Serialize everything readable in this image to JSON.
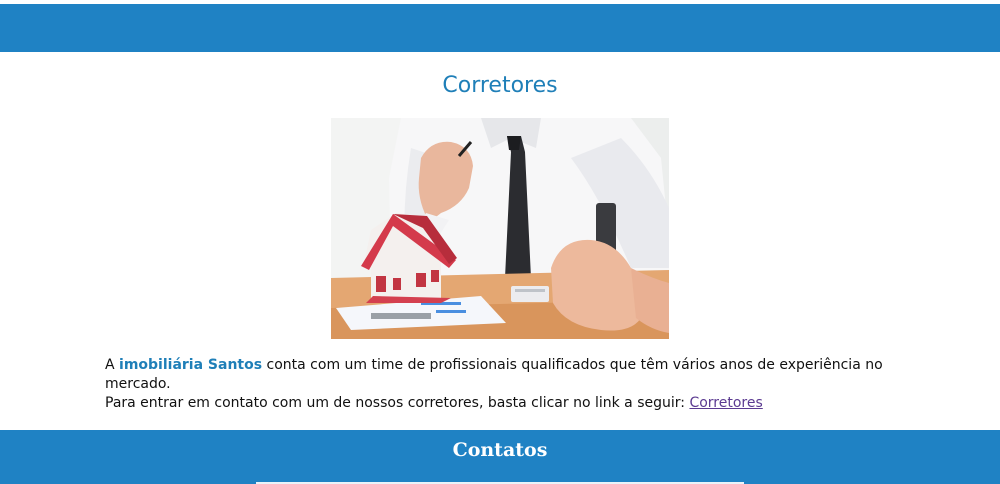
{
  "header": {
    "color": "#1f82c4"
  },
  "main": {
    "title": "Corretores",
    "image": {
      "icon": "realtor-with-house-model-photo"
    },
    "paragraph": {
      "prefix": "A ",
      "brand": "imobiliária Santos",
      "line1_rest": " conta com um time de profissionais qualificados que têm vários anos de experiência no mercado.",
      "line2": "Para entrar em contato com um de nossos corretores, basta clicar no link a seguir: ",
      "link_label": "Corretores"
    }
  },
  "footer": {
    "title": "Contatos",
    "color": "#1f82c4"
  },
  "colors": {
    "accent": "#1f7fb8",
    "link": "#5b3a91",
    "text": "#111111"
  }
}
